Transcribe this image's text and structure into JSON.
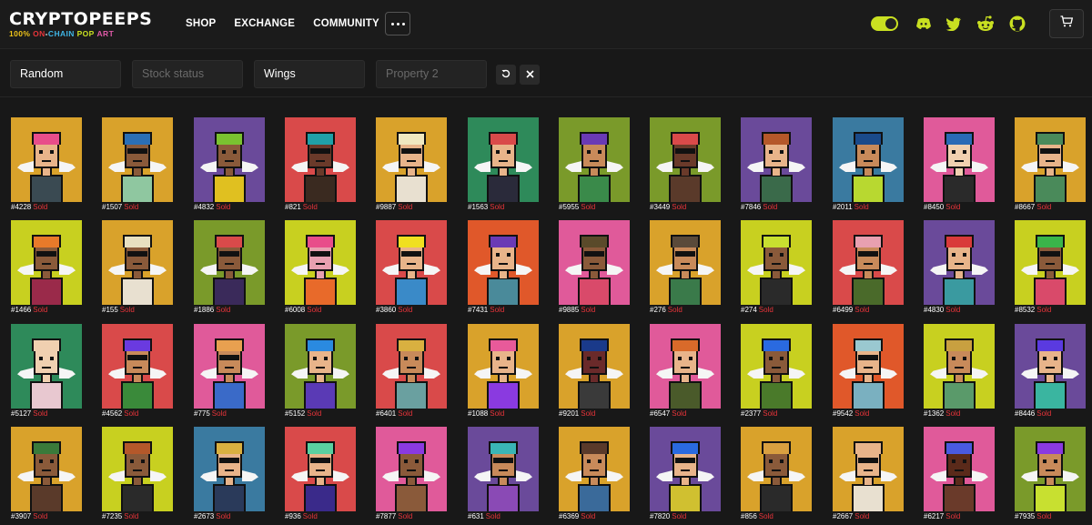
{
  "brand": {
    "title": "CRYPTOPEEPS",
    "tagline": [
      {
        "text": "100% ",
        "color": "#f0c419"
      },
      {
        "text": "ON",
        "color": "#e8343a"
      },
      {
        "text": "-",
        "color": "#ffffff"
      },
      {
        "text": "CHAIN ",
        "color": "#3fb5e5"
      },
      {
        "text": "POP ",
        "color": "#c9e021"
      },
      {
        "text": "ART",
        "color": "#e05aa8"
      }
    ]
  },
  "nav": {
    "items": [
      "SHOP",
      "EXCHANGE",
      "COMMUNITY"
    ],
    "more_icon": "ellipsis-icon"
  },
  "header_right": {
    "theme_toggle": {
      "on": true,
      "accent": "#c9e021"
    },
    "social_icons": [
      "discord-icon",
      "twitter-icon",
      "reddit-icon",
      "github-icon"
    ],
    "cart_icon": "cart-icon",
    "icon_color": "#c9e021"
  },
  "filters": [
    {
      "value": "Random",
      "placeholder": ""
    },
    {
      "value": "",
      "placeholder": "Stock status"
    },
    {
      "value": "Wings",
      "placeholder": ""
    },
    {
      "value": "",
      "placeholder": "Property 2"
    }
  ],
  "filter_actions": {
    "reset_icon": "reset-icon",
    "clear_icon": "close-icon"
  },
  "sold_label": "Sold",
  "peeps": [
    {
      "id": "#4228",
      "bg": "#d9a22b",
      "skin": "#e8b48a",
      "hair": "#e84d8a",
      "shirt": "#3a4a52",
      "shades": false
    },
    {
      "id": "#1507",
      "bg": "#d9a22b",
      "skin": "#8a5a3a",
      "hair": "#2b6fb5",
      "shirt": "#8fc7a0",
      "shades": true
    },
    {
      "id": "#4832",
      "bg": "#6a4a9a",
      "skin": "#8a5a3a",
      "hair": "#7ac230",
      "shirt": "#e0c020",
      "shades": false
    },
    {
      "id": "#821",
      "bg": "#d94a4a",
      "skin": "#6a3a2a",
      "hair": "#20a0a8",
      "shirt": "#3a2a20",
      "shades": true
    },
    {
      "id": "#9887",
      "bg": "#d9a22b",
      "skin": "#e8b48a",
      "hair": "#f0e8c0",
      "shirt": "#e8e0d0",
      "shades": true
    },
    {
      "id": "#1563",
      "bg": "#2e8a5a",
      "skin": "#e8b48a",
      "hair": "#d94a4a",
      "shirt": "#2a2a3a",
      "shades": false
    },
    {
      "id": "#5955",
      "bg": "#7a9a2a",
      "skin": "#c88a5a",
      "hair": "#6a3ab5",
      "shirt": "#3a8a4a",
      "shades": false
    },
    {
      "id": "#3449",
      "bg": "#7a9a2a",
      "skin": "#6a3a2a",
      "hair": "#d94a4a",
      "shirt": "#5a3a2a",
      "shades": true
    },
    {
      "id": "#7846",
      "bg": "#6a4a9a",
      "skin": "#e8b48a",
      "hair": "#b5582a",
      "shirt": "#3a6a4a",
      "shades": false
    },
    {
      "id": "#2011",
      "bg": "#3a7aa0",
      "skin": "#c88a5a",
      "hair": "#1a4a8a",
      "shirt": "#b8d830",
      "shades": false
    },
    {
      "id": "#8450",
      "bg": "#e05a9a",
      "skin": "#f0d0b0",
      "hair": "#2a6ab5",
      "shirt": "#2a2a2a",
      "shades": false
    },
    {
      "id": "#8667",
      "bg": "#d9a22b",
      "skin": "#e8b48a",
      "hair": "#4a8a5a",
      "shirt": "#4a8a5a",
      "shades": true
    },
    {
      "id": "#1466",
      "bg": "#c8d020",
      "skin": "#8a5a3a",
      "hair": "#e87a2a",
      "shirt": "#9a2a4a",
      "shades": true
    },
    {
      "id": "#155",
      "bg": "#d9a22b",
      "skin": "#8a5a3a",
      "hair": "#e8e0c0",
      "shirt": "#e8e0d0",
      "shades": true
    },
    {
      "id": "#1886",
      "bg": "#7a9a2a",
      "skin": "#8a5a3a",
      "hair": "#d94a4a",
      "shirt": "#3a2a5a",
      "shades": true
    },
    {
      "id": "#6008",
      "bg": "#c8d020",
      "skin": "#e8a0b0",
      "hair": "#e84d8a",
      "shirt": "#e86a2a",
      "shades": true
    },
    {
      "id": "#3860",
      "bg": "#d94a4a",
      "skin": "#e8b48a",
      "hair": "#f0e020",
      "shirt": "#3a8ac8",
      "shades": true
    },
    {
      "id": "#7431",
      "bg": "#e0582a",
      "skin": "#e8b48a",
      "hair": "#6a3ab5",
      "shirt": "#4a8a9a",
      "shades": false
    },
    {
      "id": "#9885",
      "bg": "#e05a9a",
      "skin": "#8a5a3a",
      "hair": "#5a4a2a",
      "shirt": "#d94a6a",
      "shades": true
    },
    {
      "id": "#276",
      "bg": "#d9a22b",
      "skin": "#c88a5a",
      "hair": "#5a4a3a",
      "shirt": "#3a7a4a",
      "shades": true
    },
    {
      "id": "#274",
      "bg": "#c8d020",
      "skin": "#8a5a3a",
      "hair": "#c8e030",
      "shirt": "#2a2a2a",
      "shades": false
    },
    {
      "id": "#6499",
      "bg": "#d94a4a",
      "skin": "#c88a5a",
      "hair": "#e8a0b0",
      "shirt": "#4a6a2a",
      "shades": true
    },
    {
      "id": "#4830",
      "bg": "#6a4a9a",
      "skin": "#e8b48a",
      "hair": "#d93a3a",
      "shirt": "#3a9aa0",
      "shades": false
    },
    {
      "id": "#8532",
      "bg": "#c8d020",
      "skin": "#8a5a3a",
      "hair": "#3ab54a",
      "shirt": "#d94a6a",
      "shades": true
    },
    {
      "id": "#5127",
      "bg": "#2e8a5a",
      "skin": "#f0d0b0",
      "hair": "#f0d0b0",
      "shirt": "#e8c8d0",
      "shades": false
    },
    {
      "id": "#4562",
      "bg": "#d94a4a",
      "skin": "#c88a5a",
      "hair": "#6a3ae0",
      "shirt": "#3a8a3a",
      "shades": true
    },
    {
      "id": "#775",
      "bg": "#e05a9a",
      "skin": "#c88a5a",
      "hair": "#e8a050",
      "shirt": "#3a6ac8",
      "shades": true
    },
    {
      "id": "#5152",
      "bg": "#7a9a2a",
      "skin": "#e8b48a",
      "hair": "#2a8ae0",
      "shirt": "#5a3ab5",
      "shades": false
    },
    {
      "id": "#6401",
      "bg": "#d94a4a",
      "skin": "#c88a5a",
      "hair": "#d9b040",
      "shirt": "#6aa0a0",
      "shades": false
    },
    {
      "id": "#1088",
      "bg": "#d9a22b",
      "skin": "#e8b48a",
      "hair": "#e85a9a",
      "shirt": "#8a3ae0",
      "shades": false
    },
    {
      "id": "#9201",
      "bg": "#d9a22b",
      "skin": "#6a2a2a",
      "hair": "#1a3a8a",
      "shirt": "#3a3a3a",
      "shades": false
    },
    {
      "id": "#6547",
      "bg": "#e05a9a",
      "skin": "#e8b48a",
      "hair": "#d96a2a",
      "shirt": "#4a5a2a",
      "shades": false
    },
    {
      "id": "#2377",
      "bg": "#c8d020",
      "skin": "#8a5a3a",
      "hair": "#2a6ae0",
      "shirt": "#4a7a2a",
      "shades": false
    },
    {
      "id": "#9542",
      "bg": "#e0582a",
      "skin": "#e8b48a",
      "hair": "#9ac8d0",
      "shirt": "#7ab0c0",
      "shades": true
    },
    {
      "id": "#1362",
      "bg": "#c8d020",
      "skin": "#c88a5a",
      "hair": "#c8a040",
      "shirt": "#5a9a6a",
      "shades": false
    },
    {
      "id": "#8446",
      "bg": "#6a4a9a",
      "skin": "#e8b48a",
      "hair": "#5a3ae0",
      "shirt": "#3ab5a0",
      "shades": false
    },
    {
      "id": "#3907",
      "bg": "#d9a22b",
      "skin": "#8a5a3a",
      "hair": "#3a7a3a",
      "shirt": "#5a3a2a",
      "shades": false
    },
    {
      "id": "#7235",
      "bg": "#c8d020",
      "skin": "#8a5a3a",
      "hair": "#b5582a",
      "shirt": "#2a2a2a",
      "shades": false
    },
    {
      "id": "#2673",
      "bg": "#3a7aa0",
      "skin": "#e8b48a",
      "hair": "#d9b040",
      "shirt": "#2a3a5a",
      "shades": true
    },
    {
      "id": "#936",
      "bg": "#d94a4a",
      "skin": "#e8b48a",
      "hair": "#5ad0a0",
      "shirt": "#3a2a8a",
      "shades": true
    },
    {
      "id": "#7877",
      "bg": "#e05a9a",
      "skin": "#8a5a3a",
      "hair": "#8a3ae0",
      "shirt": "#8a5a3a",
      "shades": false
    },
    {
      "id": "#631",
      "bg": "#6a4a9a",
      "skin": "#c88a5a",
      "hair": "#3ab5b5",
      "shirt": "#8a4ab5",
      "shades": true
    },
    {
      "id": "#6369",
      "bg": "#d9a22b",
      "skin": "#c88a5a",
      "hair": "#5a3a2a",
      "shirt": "#3a6a9a",
      "shades": false
    },
    {
      "id": "#7820",
      "bg": "#6a4a9a",
      "skin": "#e8b48a",
      "hair": "#2a6ae0",
      "shirt": "#d0c030",
      "shades": true
    },
    {
      "id": "#856",
      "bg": "#d9a22b",
      "skin": "#8a5a3a",
      "hair": "#d9a040",
      "shirt": "#2a2a2a",
      "shades": false
    },
    {
      "id": "#2667",
      "bg": "#d9a22b",
      "skin": "#e8b48a",
      "hair": "#e8b48a",
      "shirt": "#e8e0d0",
      "shades": true
    },
    {
      "id": "#6217",
      "bg": "#e05a9a",
      "skin": "#5a2a1a",
      "hair": "#4a5ae0",
      "shirt": "#6a3a2a",
      "shades": false
    },
    {
      "id": "#7935",
      "bg": "#7a9a2a",
      "skin": "#c88a5a",
      "hair": "#8a3ae0",
      "shirt": "#c8e030",
      "shades": false
    }
  ]
}
